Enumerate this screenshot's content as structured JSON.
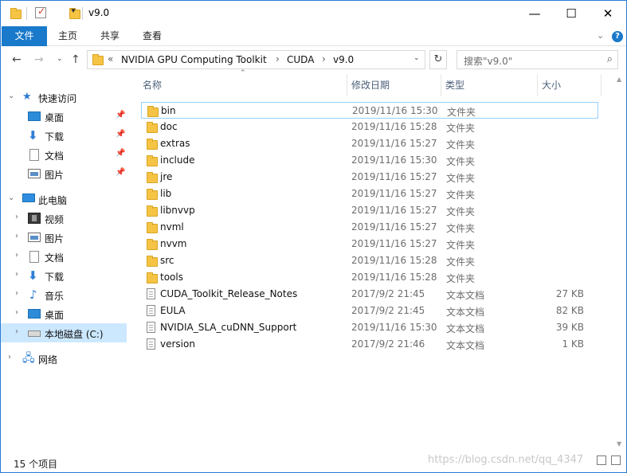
{
  "window": {
    "title": "v9.0"
  },
  "ribbon": {
    "tabs": [
      "文件",
      "主页",
      "共享",
      "查看"
    ]
  },
  "address": {
    "overflow": "«",
    "crumbs": [
      "NVIDIA GPU Computing Toolkit",
      "CUDA",
      "v9.0"
    ]
  },
  "search": {
    "placeholder": "搜索\"v9.0\""
  },
  "columns": {
    "name": "名称",
    "date": "修改日期",
    "type": "类型",
    "size": "大小"
  },
  "nav": {
    "quick_access": "快速访问",
    "quick_items": [
      "桌面",
      "下载",
      "文档",
      "图片"
    ],
    "this_pc": "此电脑",
    "pc_items": [
      "视频",
      "图片",
      "文档",
      "下载",
      "音乐",
      "桌面",
      "本地磁盘 (C:)"
    ],
    "network": "网络"
  },
  "files": [
    {
      "name": "bin",
      "date": "2019/11/16 15:30",
      "type": "文件夹",
      "size": ""
    },
    {
      "name": "doc",
      "date": "2019/11/16 15:28",
      "type": "文件夹",
      "size": ""
    },
    {
      "name": "extras",
      "date": "2019/11/16 15:27",
      "type": "文件夹",
      "size": ""
    },
    {
      "name": "include",
      "date": "2019/11/16 15:30",
      "type": "文件夹",
      "size": ""
    },
    {
      "name": "jre",
      "date": "2019/11/16 15:27",
      "type": "文件夹",
      "size": ""
    },
    {
      "name": "lib",
      "date": "2019/11/16 15:27",
      "type": "文件夹",
      "size": ""
    },
    {
      "name": "libnvvp",
      "date": "2019/11/16 15:27",
      "type": "文件夹",
      "size": ""
    },
    {
      "name": "nvml",
      "date": "2019/11/16 15:27",
      "type": "文件夹",
      "size": ""
    },
    {
      "name": "nvvm",
      "date": "2019/11/16 15:27",
      "type": "文件夹",
      "size": ""
    },
    {
      "name": "src",
      "date": "2019/11/16 15:28",
      "type": "文件夹",
      "size": ""
    },
    {
      "name": "tools",
      "date": "2019/11/16 15:28",
      "type": "文件夹",
      "size": ""
    },
    {
      "name": "CUDA_Toolkit_Release_Notes",
      "date": "2017/9/2 21:45",
      "type": "文本文档",
      "size": "27 KB"
    },
    {
      "name": "EULA",
      "date": "2017/9/2 21:45",
      "type": "文本文档",
      "size": "82 KB"
    },
    {
      "name": "NVIDIA_SLA_cuDNN_Support",
      "date": "2019/11/16 15:30",
      "type": "文本文档",
      "size": "39 KB"
    },
    {
      "name": "version",
      "date": "2017/9/2 21:46",
      "type": "文本文档",
      "size": "1 KB"
    }
  ],
  "status": {
    "count": "15 个项目"
  },
  "watermark": "https://blog.csdn.net/qq_4347"
}
